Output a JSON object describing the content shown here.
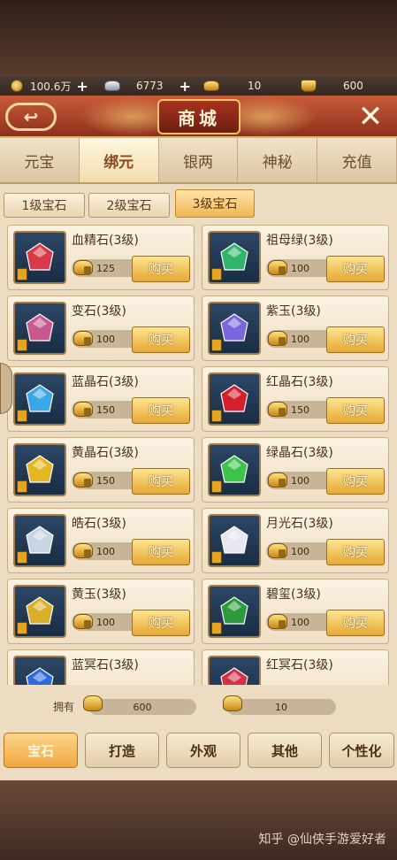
{
  "currency": {
    "coins": "100.6万",
    "silver": "6773",
    "ingots": "10",
    "bound_ingots": "600"
  },
  "header": {
    "title": "商城"
  },
  "tabs": [
    {
      "label": "元宝"
    },
    {
      "label": "绑元"
    },
    {
      "label": "银两"
    },
    {
      "label": "神秘"
    },
    {
      "label": "充值"
    }
  ],
  "subtabs": [
    {
      "label": "1级宝石"
    },
    {
      "label": "2级宝石"
    },
    {
      "label": "3级宝石"
    }
  ],
  "buy_label": "购买",
  "items": [
    {
      "name": "血精石(3级)",
      "price": "125",
      "gem_color": "#d83a4a"
    },
    {
      "name": "祖母绿(3级)",
      "price": "100",
      "gem_color": "#2fb66b"
    },
    {
      "name": "变石(3级)",
      "price": "100",
      "gem_color": "#c65a8e"
    },
    {
      "name": "紫玉(3级)",
      "price": "100",
      "gem_color": "#7c66e0"
    },
    {
      "name": "蓝晶石(3级)",
      "price": "150",
      "gem_color": "#3aa7e6"
    },
    {
      "name": "红晶石(3级)",
      "price": "150",
      "gem_color": "#d3202c"
    },
    {
      "name": "黄晶石(3级)",
      "price": "150",
      "gem_color": "#e4b624"
    },
    {
      "name": "绿晶石(3级)",
      "price": "100",
      "gem_color": "#3cc44a"
    },
    {
      "name": "皓石(3级)",
      "price": "100",
      "gem_color": "#c9d4e2"
    },
    {
      "name": "月光石(3级)",
      "price": "100",
      "gem_color": "#e6e7ef"
    },
    {
      "name": "黄玉(3级)",
      "price": "100",
      "gem_color": "#d8b02a"
    },
    {
      "name": "碧玺(3级)",
      "price": "100",
      "gem_color": "#2e9a3c"
    },
    {
      "name": "蓝冥石(3级)",
      "price": "",
      "gem_color": "#2b6ad8"
    },
    {
      "name": "红冥石(3级)",
      "price": "",
      "gem_color": "#d4304a"
    }
  ],
  "owned": {
    "label": "拥有",
    "bound_amount": "600",
    "ingot_amount": "10"
  },
  "bottom_tabs": [
    {
      "label": "宝石"
    },
    {
      "label": "打造"
    },
    {
      "label": "外观"
    },
    {
      "label": "其他"
    },
    {
      "label": "个性化"
    }
  ],
  "watermark": "知乎 @仙侠手游爱好者"
}
